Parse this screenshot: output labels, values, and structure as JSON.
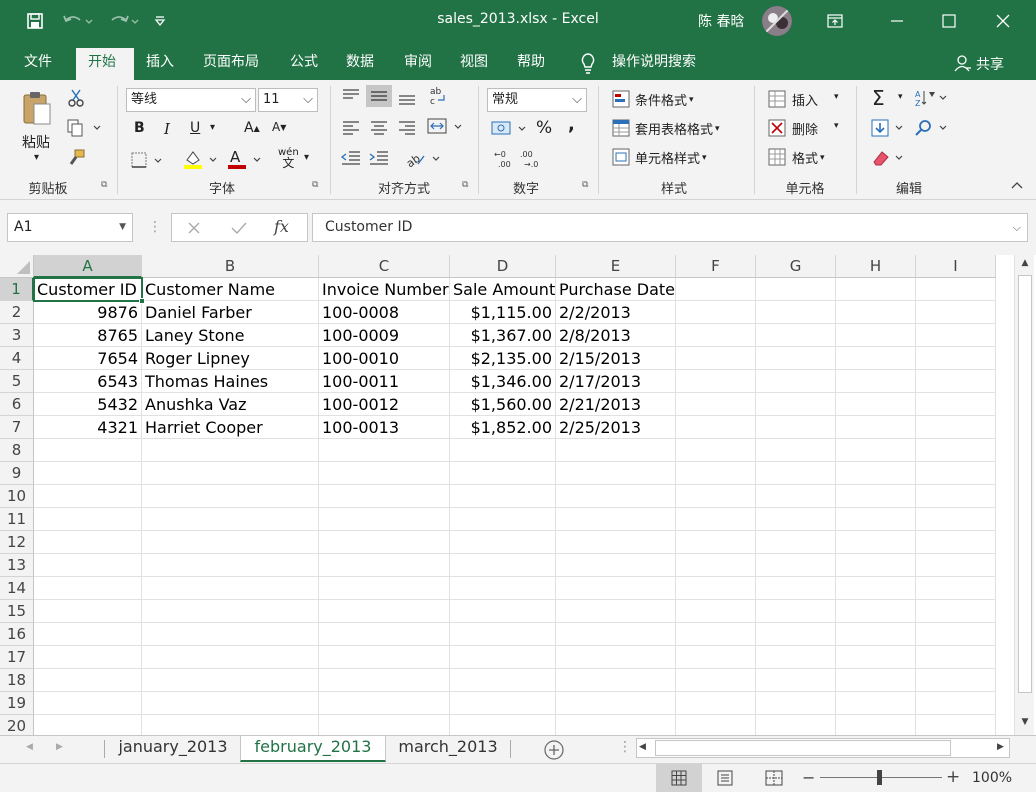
{
  "window": {
    "title": "sales_2013.xlsx  -  Excel",
    "user": "陈 春晗",
    "colors": {
      "brand": "#217346",
      "ribbon_bg": "#f3f3f3",
      "font_color_bar": "#c00000",
      "highlight_bar": "#ffff00"
    }
  },
  "ribbon_tabs": [
    "文件",
    "开始",
    "插入",
    "页面布局",
    "公式",
    "数据",
    "审阅",
    "视图",
    "帮助"
  ],
  "active_tab": "开始",
  "tell_me": "操作说明搜索",
  "share": "共享",
  "groups": {
    "clipboard": {
      "label": "剪贴板",
      "paste": "粘贴"
    },
    "font": {
      "label": "字体",
      "font_name": "等线",
      "font_size": "11",
      "bold": "B",
      "italic": "I",
      "underline": "U",
      "grow": "A",
      "shrink": "A",
      "phonetic": "wén"
    },
    "alignment": {
      "label": "对齐方式"
    },
    "number": {
      "label": "数字",
      "format": "常规",
      "percent": "%",
      "comma": ","
    },
    "styles": {
      "label": "样式",
      "conditional": "条件格式",
      "table": "套用表格格式",
      "cell_styles": "单元格样式"
    },
    "cells": {
      "label": "单元格",
      "insert": "插入",
      "delete": "删除",
      "format": "格式"
    },
    "editing": {
      "label": "编辑"
    }
  },
  "formula_bar": {
    "name_box": "A1",
    "content": "Customer ID",
    "fx": "fx"
  },
  "columns": [
    "A",
    "B",
    "C",
    "D",
    "E",
    "F",
    "G",
    "H",
    "I"
  ],
  "rows": [
    "1",
    "2",
    "3",
    "4",
    "5",
    "6",
    "7",
    "8",
    "9",
    "10",
    "11",
    "12",
    "13",
    "14",
    "15",
    "16",
    "17",
    "18",
    "19",
    "20"
  ],
  "table": {
    "headers": [
      "Customer ID",
      "Customer Name",
      "Invoice Number",
      "Sale Amount",
      "Purchase Date"
    ],
    "rows": [
      [
        "9876",
        "Daniel Farber",
        "100-0008",
        "$1,115.00",
        "2/2/2013"
      ],
      [
        "8765",
        "Laney Stone",
        "100-0009",
        "$1,367.00",
        "2/8/2013"
      ],
      [
        "7654",
        "Roger Lipney",
        "100-0010",
        "$2,135.00",
        "2/15/2013"
      ],
      [
        "6543",
        "Thomas Haines",
        "100-0011",
        "$1,346.00",
        "2/17/2013"
      ],
      [
        "5432",
        "Anushka Vaz",
        "100-0012",
        "$1,560.00",
        "2/21/2013"
      ],
      [
        "4321",
        "Harriet Cooper",
        "100-0013",
        "$1,852.00",
        "2/25/2013"
      ]
    ]
  },
  "sheets": [
    "january_2013",
    "february_2013",
    "march_2013"
  ],
  "active_sheet": "february_2013",
  "status": {
    "zoom": "100%",
    "minus": "−",
    "plus": "+"
  }
}
